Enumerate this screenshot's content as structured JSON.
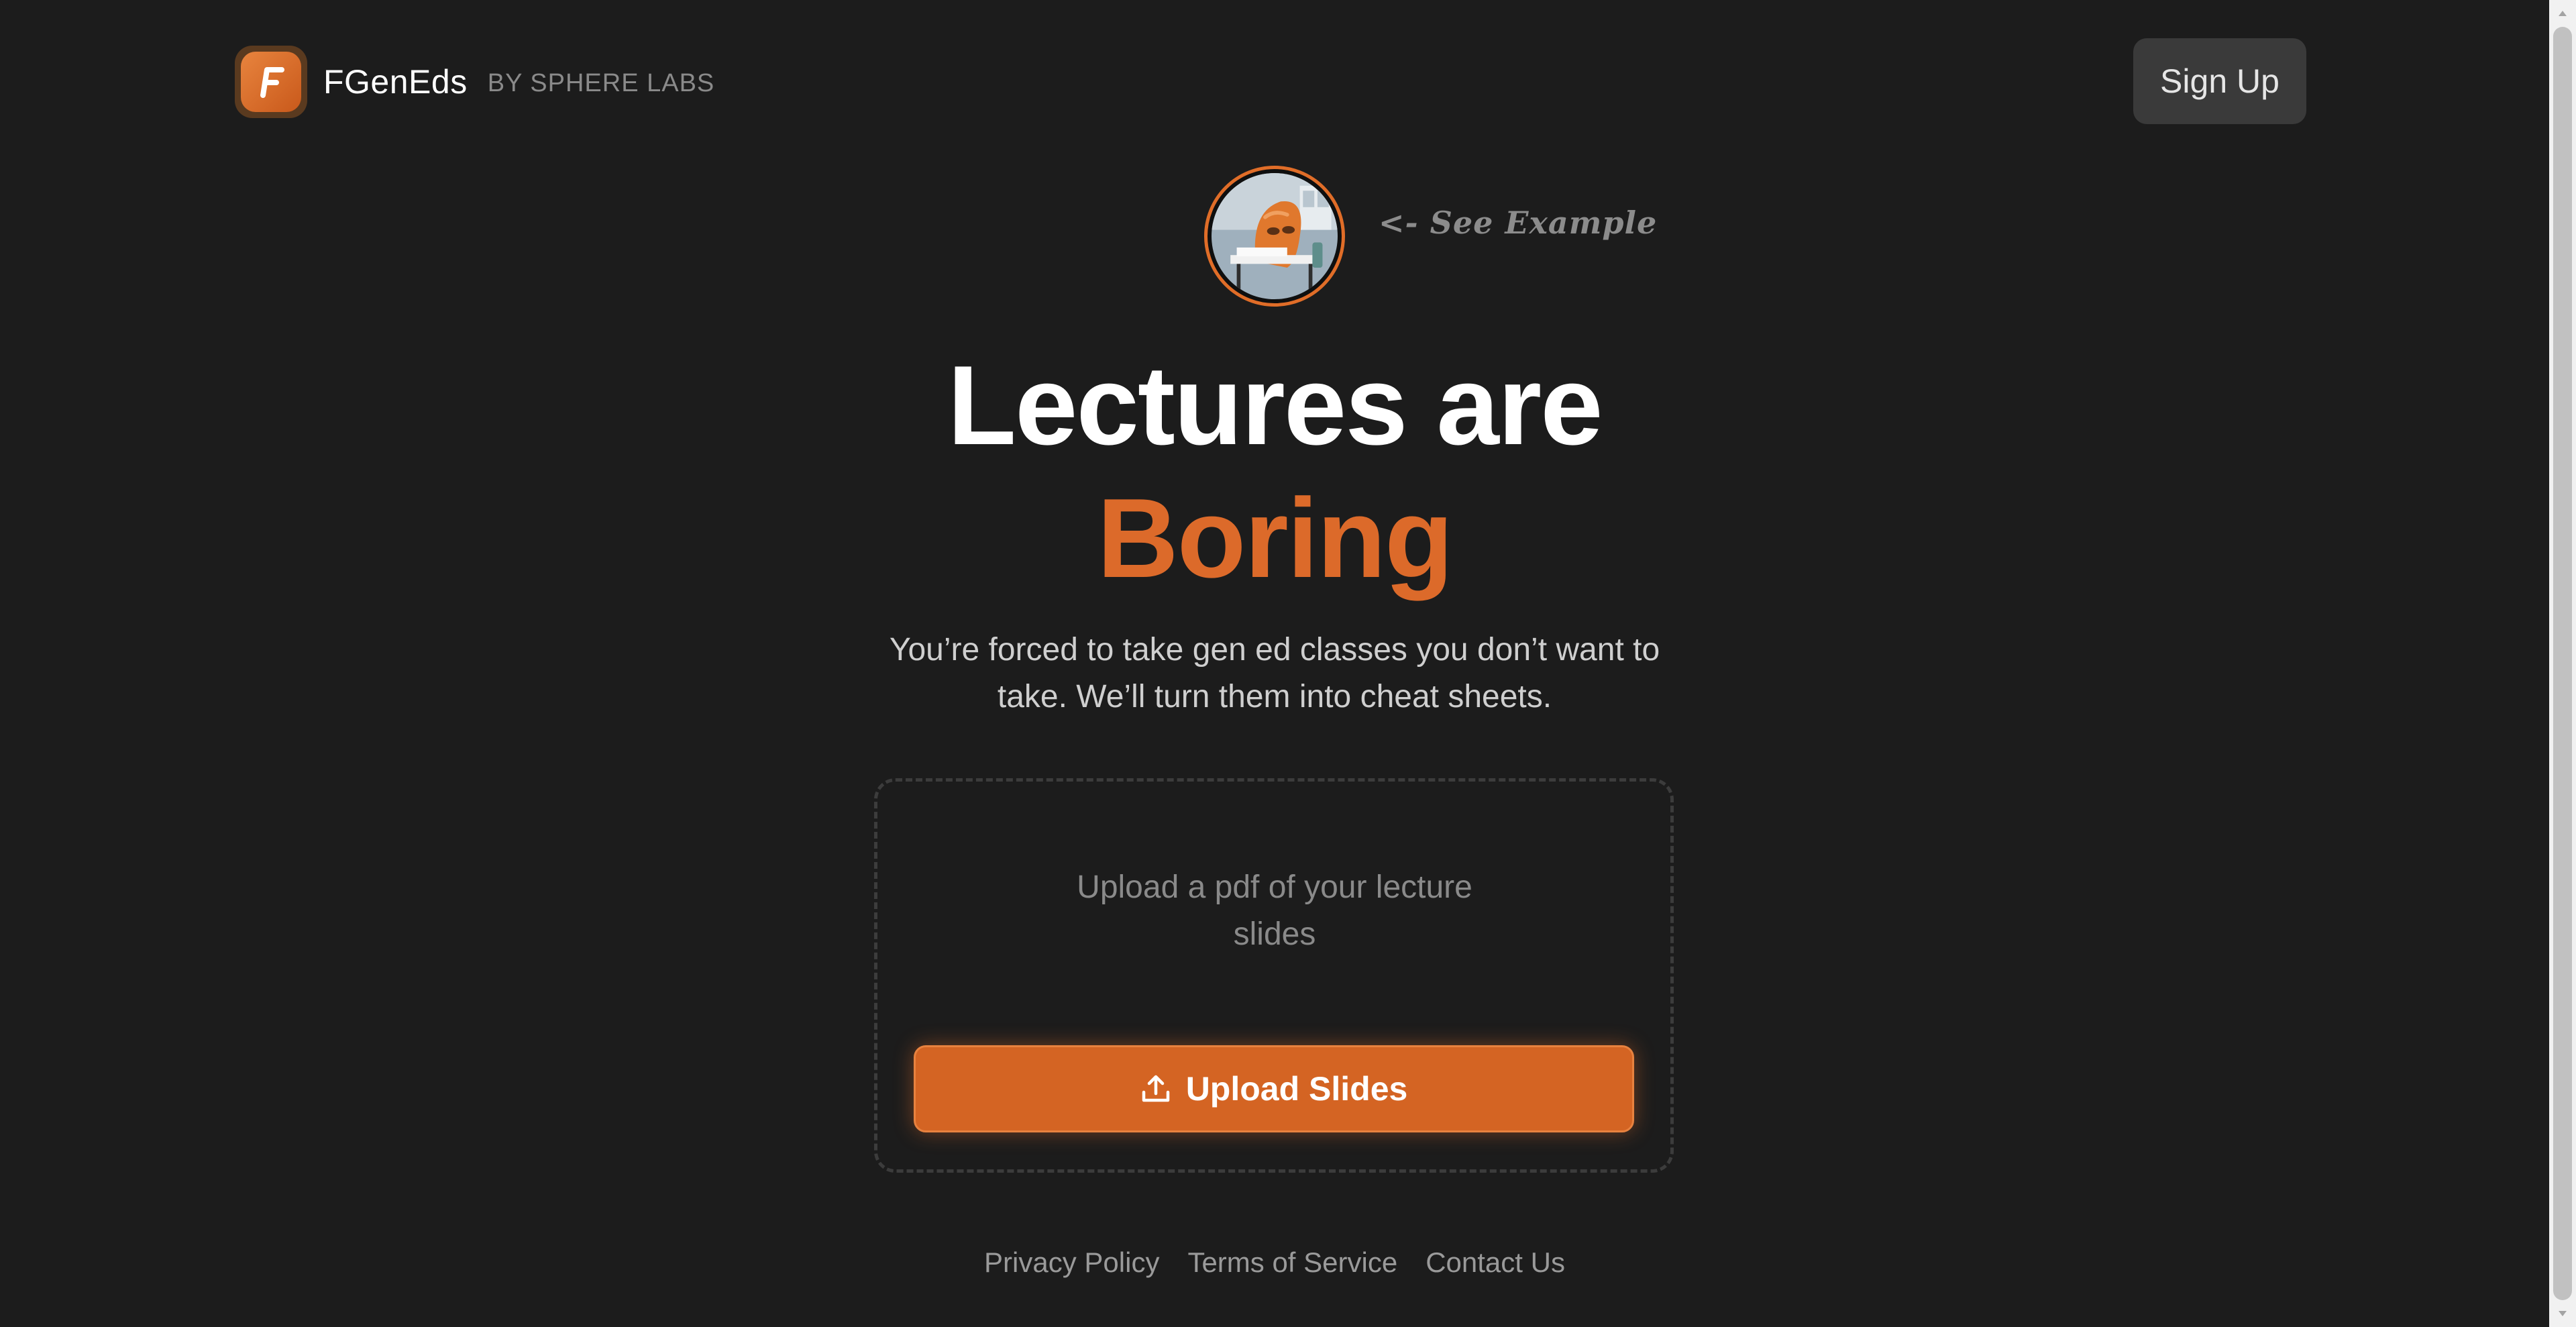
{
  "header": {
    "brand_name": "FGenEds",
    "brand_by": "BY SPHERE LABS",
    "signup_label": "Sign Up"
  },
  "example": {
    "label": "<- See Example"
  },
  "hero": {
    "line1": "Lectures are",
    "line2": "Boring",
    "subtitle": "You’re forced to take gen ed classes you don’t want to take. We’ll turn them into cheat sheets."
  },
  "upload": {
    "hint": "Upload a pdf of your lecture slides",
    "button_label": "Upload Slides"
  },
  "footer": {
    "links": [
      "Privacy Policy",
      "Terms of Service",
      "Contact Us"
    ]
  },
  "colors": {
    "accent": "#dc6a2a",
    "background": "#1c1c1c",
    "button_bg": "#d46423"
  },
  "icons": {
    "logo": "letter-f-logo-icon",
    "upload": "upload-icon"
  }
}
